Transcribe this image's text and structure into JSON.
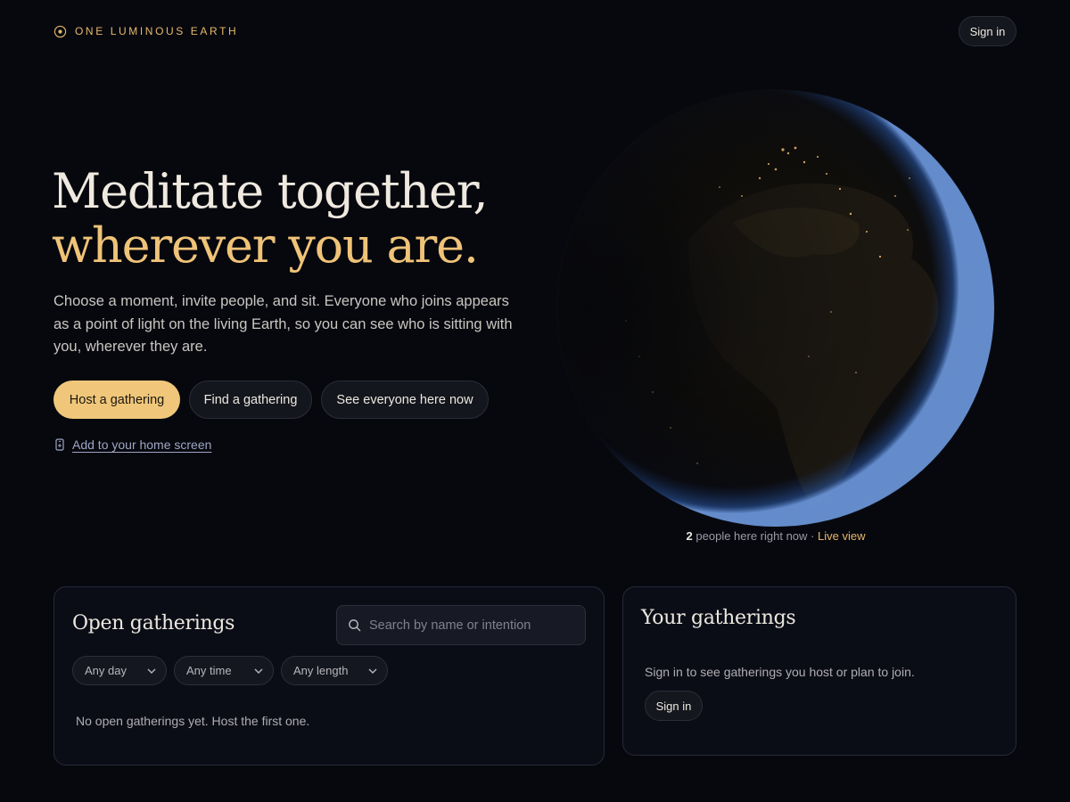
{
  "brand": {
    "name": "ONE LUMINOUS EARTH",
    "icon": "sun-dot-icon",
    "accent": "#e6b96a"
  },
  "header": {
    "signin_label": "Sign in"
  },
  "hero": {
    "title_line1": "Meditate together,",
    "title_line2": "wherever you are.",
    "subtitle": "Choose a moment, invite people, and sit. Everyone who joins appears as a point of light on the living Earth, so you can see who is sitting with you, wherever they are.",
    "buttons": {
      "host": "Host a gathering",
      "find": "Find a gathering",
      "see": "See everyone here now"
    },
    "add_home": {
      "icon": "phone-icon",
      "label": "Add to your home screen"
    }
  },
  "live": {
    "count": "2",
    "text": " people here right now · ",
    "link": "Live view"
  },
  "open_gatherings": {
    "title": "Open gatherings",
    "search_placeholder": "Search by name or intention",
    "filters": [
      "Any day",
      "Any time",
      "Any length"
    ],
    "empty": "No open gatherings yet. Host the first one."
  },
  "your_gatherings": {
    "title": "Your gatherings",
    "note": "Sign in to see gatherings you host or plan to join.",
    "signin_label": "Sign in"
  },
  "colors": {
    "background": "#07080e",
    "gold": "#f0c77a",
    "card_border": "#262a38",
    "link": "#9ea6c4"
  }
}
